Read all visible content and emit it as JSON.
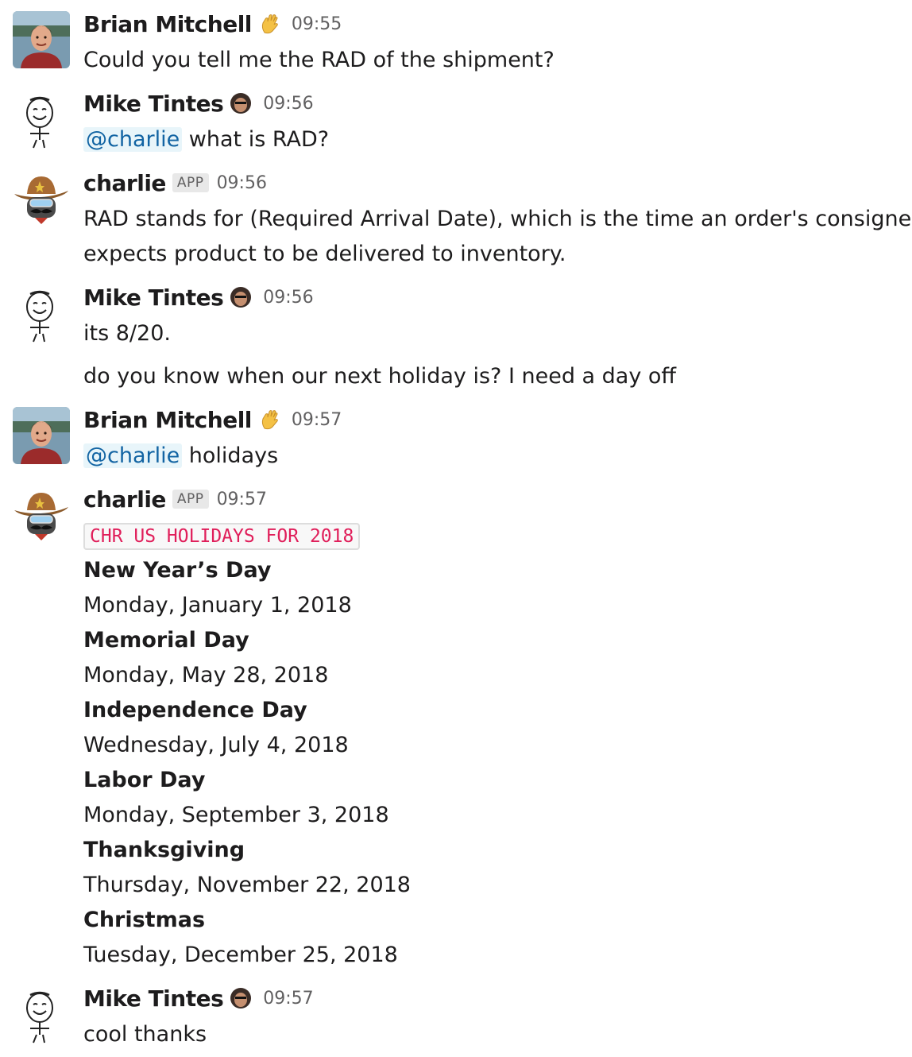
{
  "messages": [
    {
      "author": "Brian Mitchell",
      "time": "09:55",
      "text": "Could you tell me the RAD of the shipment?"
    },
    {
      "author": "Mike Tintes",
      "time": "09:56",
      "mention": "@charlie",
      "text": " what is RAD?"
    },
    {
      "author": "charlie",
      "badge": "APP",
      "time": "09:56",
      "lines": [
        "RAD stands for (Required Arrival Date), which is the time an order's consignee",
        "expects product to be delivered to inventory."
      ]
    },
    {
      "author": "Mike Tintes",
      "time": "09:56",
      "lines": [
        "its 8/20.",
        "do you know when our next holiday is? I need a day off"
      ]
    },
    {
      "author": "Brian Mitchell",
      "time": "09:57",
      "mention": "@charlie",
      "text": " holidays"
    },
    {
      "author": "charlie",
      "badge": "APP",
      "time": "09:57",
      "code": "CHR US HOLIDAYS FOR 2018",
      "holidays": [
        {
          "name": "New Year’s Day",
          "date": "Monday, January 1, 2018"
        },
        {
          "name": "Memorial Day",
          "date": "Monday, May 28, 2018"
        },
        {
          "name": "Independence Day",
          "date": "Wednesday, July 4, 2018"
        },
        {
          "name": "Labor Day",
          "date": "Monday, September 3, 2018"
        },
        {
          "name": "Thanksgiving",
          "date": "Thursday, November 22, 2018"
        },
        {
          "name": "Christmas",
          "date": "Tuesday, December 25, 2018"
        }
      ]
    },
    {
      "author": "Mike Tintes",
      "time": "09:57",
      "text": "cool thanks"
    }
  ],
  "icons": {
    "brian_status": "waving-hand-icon",
    "mike_status": "person-face-icon",
    "brian_avatar": "photo-avatar",
    "mike_avatar": "stick-figure-avatar",
    "charlie_avatar": "cowboy-robot-avatar"
  },
  "colors": {
    "mention": "#1264a3",
    "mention_bg": "#e8f5fa",
    "code_text": "#e01e5a",
    "timestamp": "#616061"
  }
}
